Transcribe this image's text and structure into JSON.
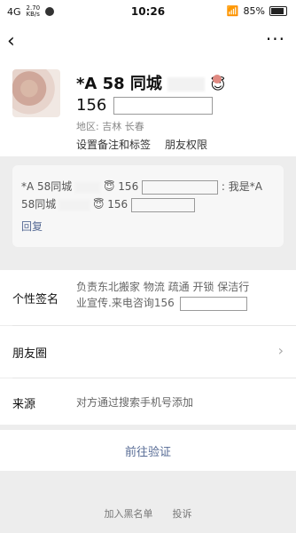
{
  "status_bar": {
    "left_top": "4G",
    "left_sub": "2.70",
    "left_unit": "KB/s",
    "time": "10:26",
    "wifi_icon": "wifi-icon",
    "battery_percent": "85%"
  },
  "nav": {
    "back_icon": "back-icon",
    "more_icon": "more-icon"
  },
  "profile": {
    "nickname_prefix": "*A 58 同城",
    "nickname_emoji": "😇",
    "number_prefix": "156",
    "region_label": "地区:",
    "region_value": "吉林 长春",
    "set_remark": "设置备注和标签",
    "friend_permission": "朋友权限"
  },
  "verify": {
    "line1_prefix": "*A 58同城",
    "line1_emoji": "😇",
    "line1_number": "156",
    "line1_text": "我是*A",
    "line2_prefix": "58同城",
    "line2_emoji": "😇",
    "line2_number": "156",
    "reply": "回复"
  },
  "signature": {
    "label": "个性签名",
    "value_line1": "负责东北搬家 物流 疏通 开锁 保洁行",
    "value_line2": "业宣传.来电咨询156"
  },
  "moments": {
    "label": "朋友圈"
  },
  "source": {
    "label": "来源",
    "value": "对方通过搜索手机号添加"
  },
  "action": {
    "goto_verify": "前往验证"
  },
  "footer": {
    "blacklist": "加入黑名单",
    "report": "投诉"
  }
}
